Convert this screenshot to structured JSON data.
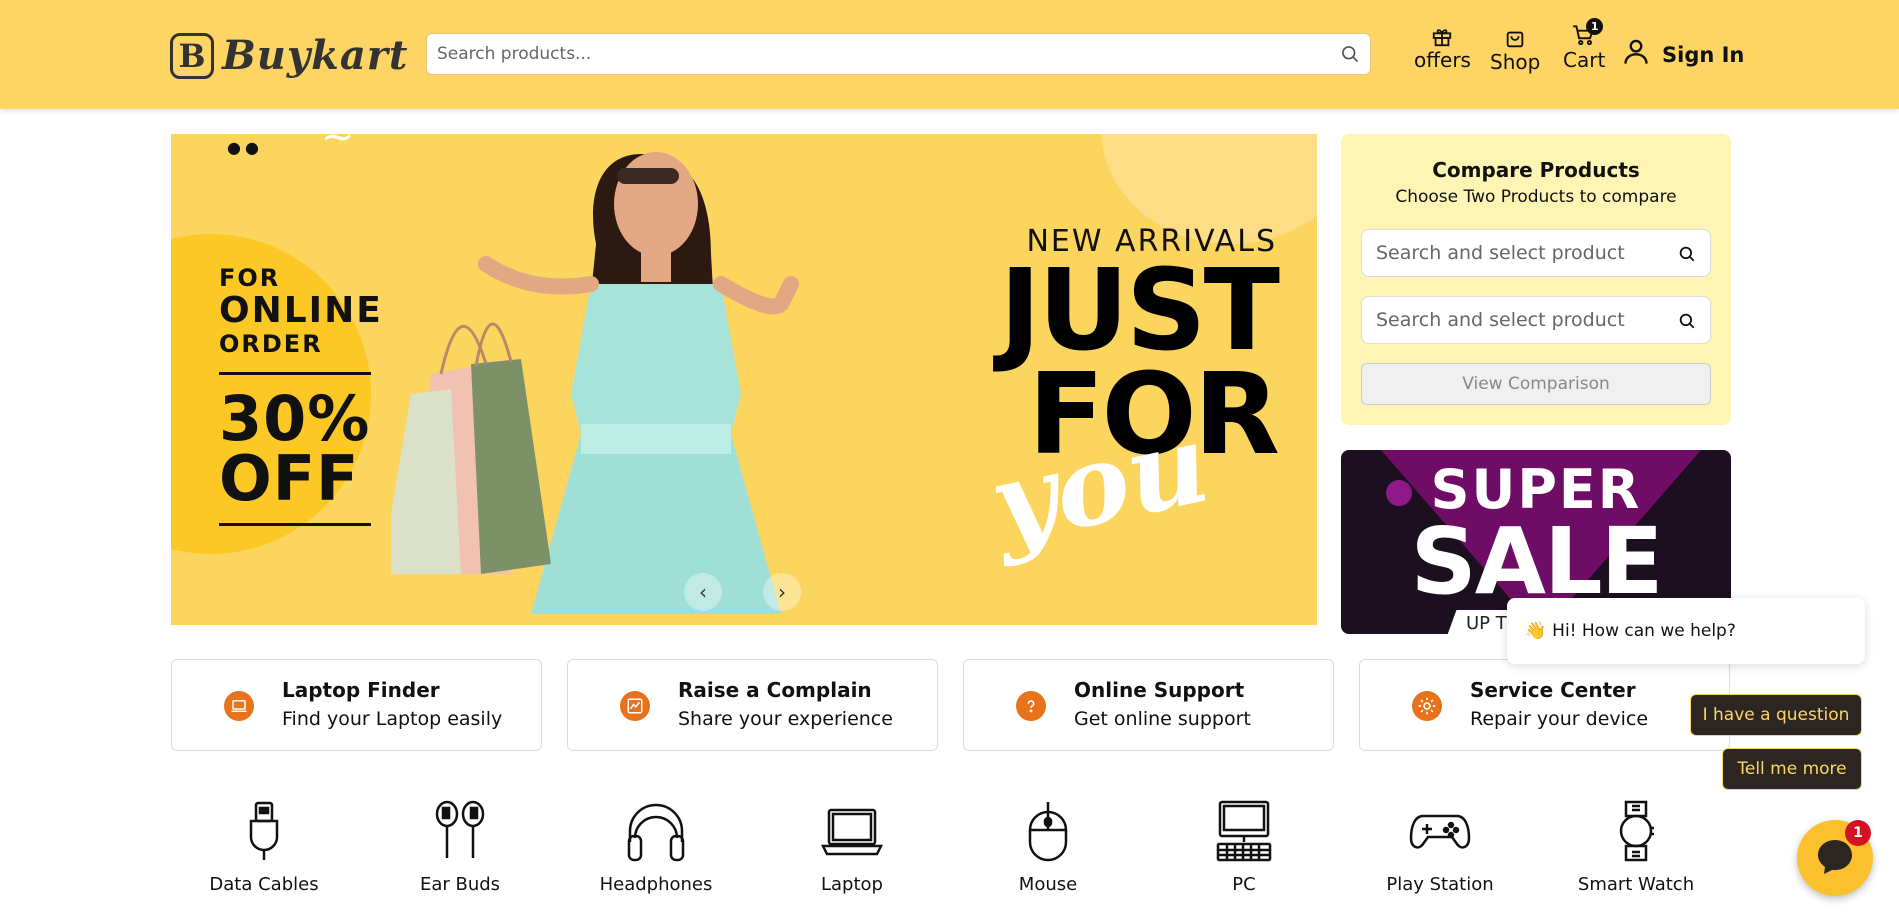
{
  "header": {
    "logo_letter": "B",
    "logo_text": "Buykart",
    "search_placeholder": "Search products...",
    "nav": {
      "offers": "offers",
      "shop": "Shop",
      "cart": "Cart",
      "cart_count": "1",
      "sign_in": "Sign In"
    },
    "background": "#fed564"
  },
  "hero": {
    "left_offer": {
      "line1": "FOR",
      "line2": "ONLINE",
      "line3": "ORDER",
      "pct": "30%",
      "off": "OFF"
    },
    "new_arrivals": "NEW ARRIVALS",
    "just": "JUST",
    "for": "FOR",
    "you": "you",
    "prev": "‹",
    "next": "›"
  },
  "compare": {
    "title": "Compare Products",
    "subtitle": "Choose Two Products to compare",
    "input1_placeholder": "Search and select product",
    "input2_placeholder": "Search and select product",
    "button": "View Comparison"
  },
  "sale_banner": {
    "line1": "SUPER",
    "line2": "SALE",
    "line3": "UP T"
  },
  "features": [
    {
      "title": "Laptop Finder",
      "subtitle": "Find your Laptop easily",
      "icon": "laptop-icon"
    },
    {
      "title": "Raise a Complain",
      "subtitle": "Share your experience",
      "icon": "chart-icon"
    },
    {
      "title": "Online Support",
      "subtitle": "Get online support",
      "icon": "question-icon"
    },
    {
      "title": "Service Center",
      "subtitle": "Repair your device",
      "icon": "gear-icon"
    }
  ],
  "categories": [
    {
      "label": "Data Cables",
      "icon": "cable-icon"
    },
    {
      "label": "Ear Buds",
      "icon": "earbuds-icon"
    },
    {
      "label": "Headphones",
      "icon": "headphones-icon"
    },
    {
      "label": "Laptop",
      "icon": "laptop-icon"
    },
    {
      "label": "Mouse",
      "icon": "mouse-icon"
    },
    {
      "label": "PC",
      "icon": "pc-icon"
    },
    {
      "label": "Play Station",
      "icon": "gamepad-icon"
    },
    {
      "label": "Smart Watch",
      "icon": "watch-icon"
    }
  ],
  "chat": {
    "wave": "👋",
    "greeting": "Hi! How can we help?",
    "option1": "I have a question",
    "option2": "Tell me more",
    "unread": "1"
  }
}
